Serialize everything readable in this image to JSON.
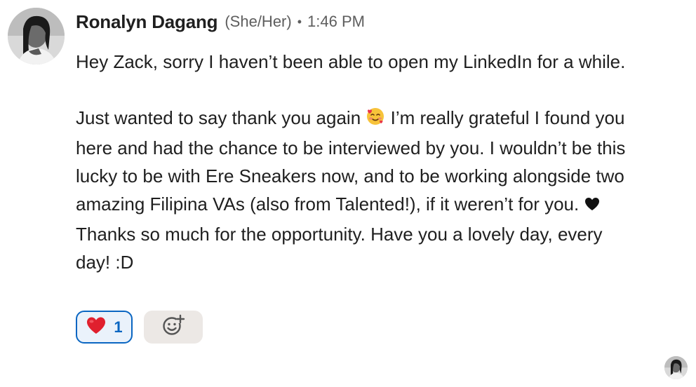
{
  "sender": {
    "name": "Ronalyn Dagang",
    "pronouns": "(She/Her)",
    "separator": "•",
    "time": "1:46 PM"
  },
  "message": {
    "paragraph1": "Hey Zack, sorry I haven’t been able to open my LinkedIn for a while.",
    "p2_part1": "Just wanted to say thank you again ",
    "p2_part2": " I’m really grateful I found you here and had the chance to be interviewed by you. I wouldn’t be this lucky to be with Ere Sneakers now, and to be working alongside two amazing Filipina VAs (also from Talented!), if it weren’t for you. ",
    "p2_part3": " Thanks so much for the opportunity. Have you a lovely day, every day! :D"
  },
  "reactions": [
    {
      "icon": "red-heart-emoji",
      "count": "1"
    }
  ],
  "icons": {
    "inline_emoji_1": "smiling-face-with-hearts",
    "inline_emoji_2": "black-heart",
    "add_reaction": "add-reaction-smiley-plus"
  },
  "colors": {
    "reaction_border": "#0a66c2",
    "reaction_bg": "#eaf2fb",
    "add_reaction_bg": "#ece8e5",
    "text": "#1f1f1f",
    "meta_text": "#5e5e5e"
  }
}
